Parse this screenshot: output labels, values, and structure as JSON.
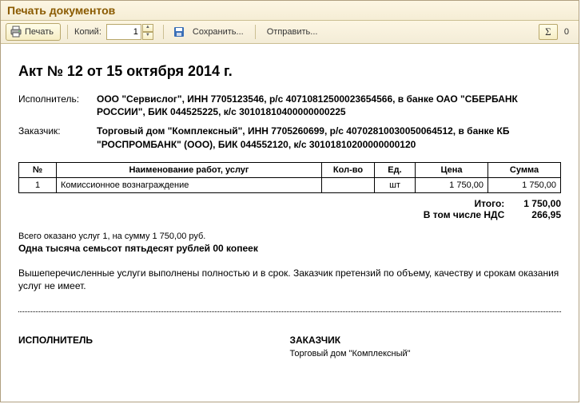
{
  "window": {
    "title": "Печать документов"
  },
  "toolbar": {
    "print_label": "Печать",
    "copies_label": "Копий:",
    "copies_value": "1",
    "save_label": "Сохранить...",
    "send_label": "Отправить...",
    "sum_value": "0"
  },
  "document": {
    "title": "Акт № 12 от 15 октября 2014 г.",
    "executor_label": "Исполнитель:",
    "executor_value": "ООО \"Сервислог\", ИНН 7705123546, р/с 40710812500023654566, в банке ОАО \"СБЕРБАНК РОССИИ\", БИК 044525225, к/с 30101810400000000225",
    "customer_label": "Заказчик:",
    "customer_value": "Торговый дом \"Комплексный\", ИНН 7705260699, р/с 40702810030050064512, в банке КБ \"РОСПРОМБАНК\" (ООО), БИК 044552120, к/с 30101810200000000120",
    "columns": {
      "no": "№",
      "name": "Наименование работ, услуг",
      "qty": "Кол-во",
      "unit": "Ед.",
      "price": "Цена",
      "sum": "Сумма"
    },
    "rows": [
      {
        "no": "1",
        "name": "Комиссионное вознаграждение",
        "qty": "",
        "unit": "шт",
        "price": "1 750,00",
        "sum": "1 750,00"
      }
    ],
    "totals": {
      "total_label": "Итого:",
      "total_value": "1 750,00",
      "vat_label": "В том числе НДС",
      "vat_value": "266,95"
    },
    "summary": "Всего оказано услуг 1, на сумму 1 750,00 руб.",
    "amount_words": "Одна тысяча семьсот пятьдесят рублей 00 копеек",
    "note": "Вышеперечисленные услуги выполнены полностью и в срок. Заказчик претензий по объему, качеству и срокам оказания услуг не имеет.",
    "signatures": {
      "executor_title": "ИСПОЛНИТЕЛЬ",
      "customer_title": "ЗАКАЗЧИК",
      "customer_name": "Торговый дом \"Комплексный\""
    }
  }
}
